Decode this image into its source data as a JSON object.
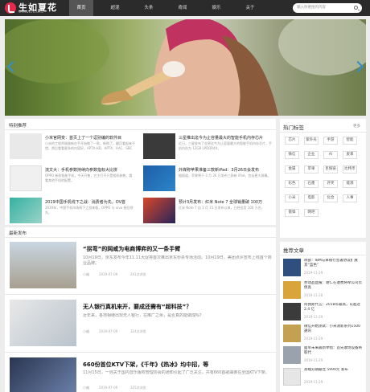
{
  "header": {
    "logo_text": "生如夏花",
    "logo_sub": "SHENGRUXIAHUA",
    "nav": [
      "首页",
      "超混",
      "头条",
      "奇闻",
      "娱乐",
      "关于"
    ],
    "search_placeholder": "输入你要搜的内容"
  },
  "featured": {
    "title": "特别推荐",
    "items": [
      {
        "title": "小米官网变：首页上了一个逗别编的软件目",
        "desc": "小米的工程师刚刚新在手开始做了一款，新购了。翻页看起来不错，然后看看更多的内容好，APTX-HD、APTX、AAC、SBC"
      },
      {
        "title": "三星推出迄今为止容量最大的智能手机内存芯片",
        "desc": "近日，三星发布了业界迄今为止容量最大的智能手机内存芯片，手机内存为 12GB LPDDR4X。"
      },
      {
        "title": "流文大：手机参数持续向参数指标大比拼",
        "desc": "OPPO 新款智能手机，今天开售，它主打不只是相机参数，看看其他手机的配置，"
      },
      {
        "title": "外媒称苹果准备三款新iPad：3月26日会发布",
        "desc": "据报道，苹果将于 3 月 26 日发布三款新 iPad，包括更大屏幕。"
      },
      {
        "title": "2019中国手机线下之战：消费者为先，OV首",
        "desc": "2019年，中国手机市场线下之战来临，OPPO 与 vivo 依旧领先。"
      },
      {
        "title": "预计3月发布：红米 Note 7 全球销量破 100万",
        "desc": "红米 Note 7 自 1 月 15 日发布以来，已经出货 100 万台。"
      }
    ]
  },
  "latest": {
    "title": "最新发布",
    "items": [
      {
        "title": "“拐弯”的网咸为电商博弈的又一条手臂",
        "excerpt": "10月19日，京东发布今年11.11大促将首次推出京东秒杀专场活动。10月19日，美团点评宣布上线首个商业品牌。",
        "author": "小编",
        "date": "2019-07-09",
        "views": "241次浏览"
      },
      {
        "title": "无人银行真机来开，要成还需有“超科技”？",
        "excerpt": "近年来，各地相继出现无人银行，在推广之余，是否真的能做成吗？",
        "author": "小编",
        "date": "2019-07-09",
        "views": "324次浏览"
      },
      {
        "title": "660份首位KTV下架，《千年》《热冰》均中招，等",
        "excerpt": "11月15日，一则关于国内音乐版权管理协会的通知引起了广泛关注，共有660首歌曲要在全国KTV下架。",
        "author": "小编",
        "date": "2019-07-09",
        "views": "325次浏览"
      }
    ]
  },
  "hot_tags": {
    "title": "热门标签",
    "more": "更多",
    "tags": [
      "芯片",
      "紫外光",
      "手游",
      "智能",
      "微信",
      "企业",
      "AI",
      "皮革",
      "金属",
      "苹果",
      "巨辉链",
      "比特币",
      "彩色",
      "石墨",
      "开奖",
      "能源",
      "小米",
      "电影",
      "化合",
      "人事",
      "雷锋",
      "网吧"
    ]
  },
  "recommended": {
    "title": "推荐文章",
    "items": [
      {
        "title": "除部：IBM与卓银行签署协议扩展其“蓝色”",
        "date": "2019-11-29"
      },
      {
        "title": "亦动品直报：谢仁在收费将牵公司负债高",
        "date": "2019-11-28"
      },
      {
        "title": "阿我斯代言：2018年最高，以超过2.4 亿",
        "date": "2019-11-29"
      },
      {
        "title": "微信开始测试：小米测新系列1500通讯",
        "date": "2019-11-29"
      },
      {
        "title": "面单未来最新举措：首先收场设备将取代",
        "date": "2019-11-29"
      },
      {
        "title": "高端分期最佳 5999元 发布",
        "date": "2019-11-29"
      }
    ]
  },
  "colors": {
    "header": "#2b2b2b",
    "accent": "#e8294a",
    "arrow": "#2f8fd0"
  }
}
